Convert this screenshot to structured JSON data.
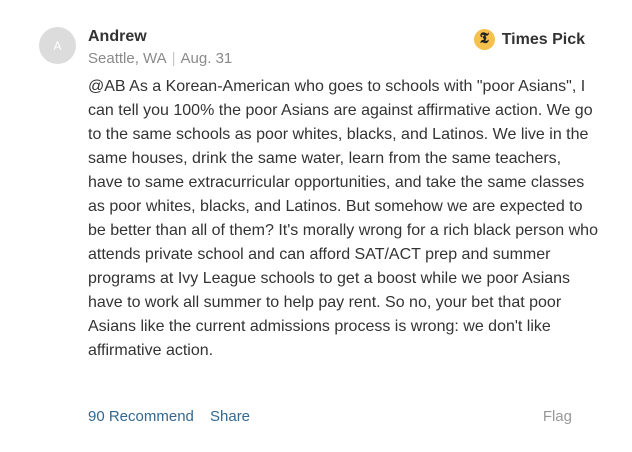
{
  "comment": {
    "avatar_initial": "A",
    "author": "Andrew",
    "location": "Seattle, WA",
    "meta_separator": "|",
    "date": "Aug. 31",
    "times_pick": {
      "badge_glyph": "ᵗ",
      "label": "Times Pick"
    },
    "body": "@AB As a Korean-American who goes to schools with \"poor Asians\", I can tell you 100% the poor Asians are against affirmative action. We go to the same schools as poor whites, blacks, and Latinos. We live in the same houses, drink the same water, learn from the same teachers, have to same extracurricular opportunities, and take the same classes as poor whites, blacks, and Latinos. But somehow we are expected to be better than all of them? It's morally wrong for a rich black person who attends private school and can afford SAT/ACT prep and summer programs at Ivy League schools to get a boost while we poor Asians have to work all summer to help pay rent. So no, your bet that poor Asians like the current admissions process is wrong: we don't like affirmative action.",
    "actions": {
      "recommend_label": "90 Recommend",
      "share_label": "Share",
      "flag_label": "Flag"
    }
  },
  "colors": {
    "link": "#326891",
    "meta": "#8a8a8a",
    "badge": "#f6c04c",
    "avatar": "#dcdcdc"
  }
}
